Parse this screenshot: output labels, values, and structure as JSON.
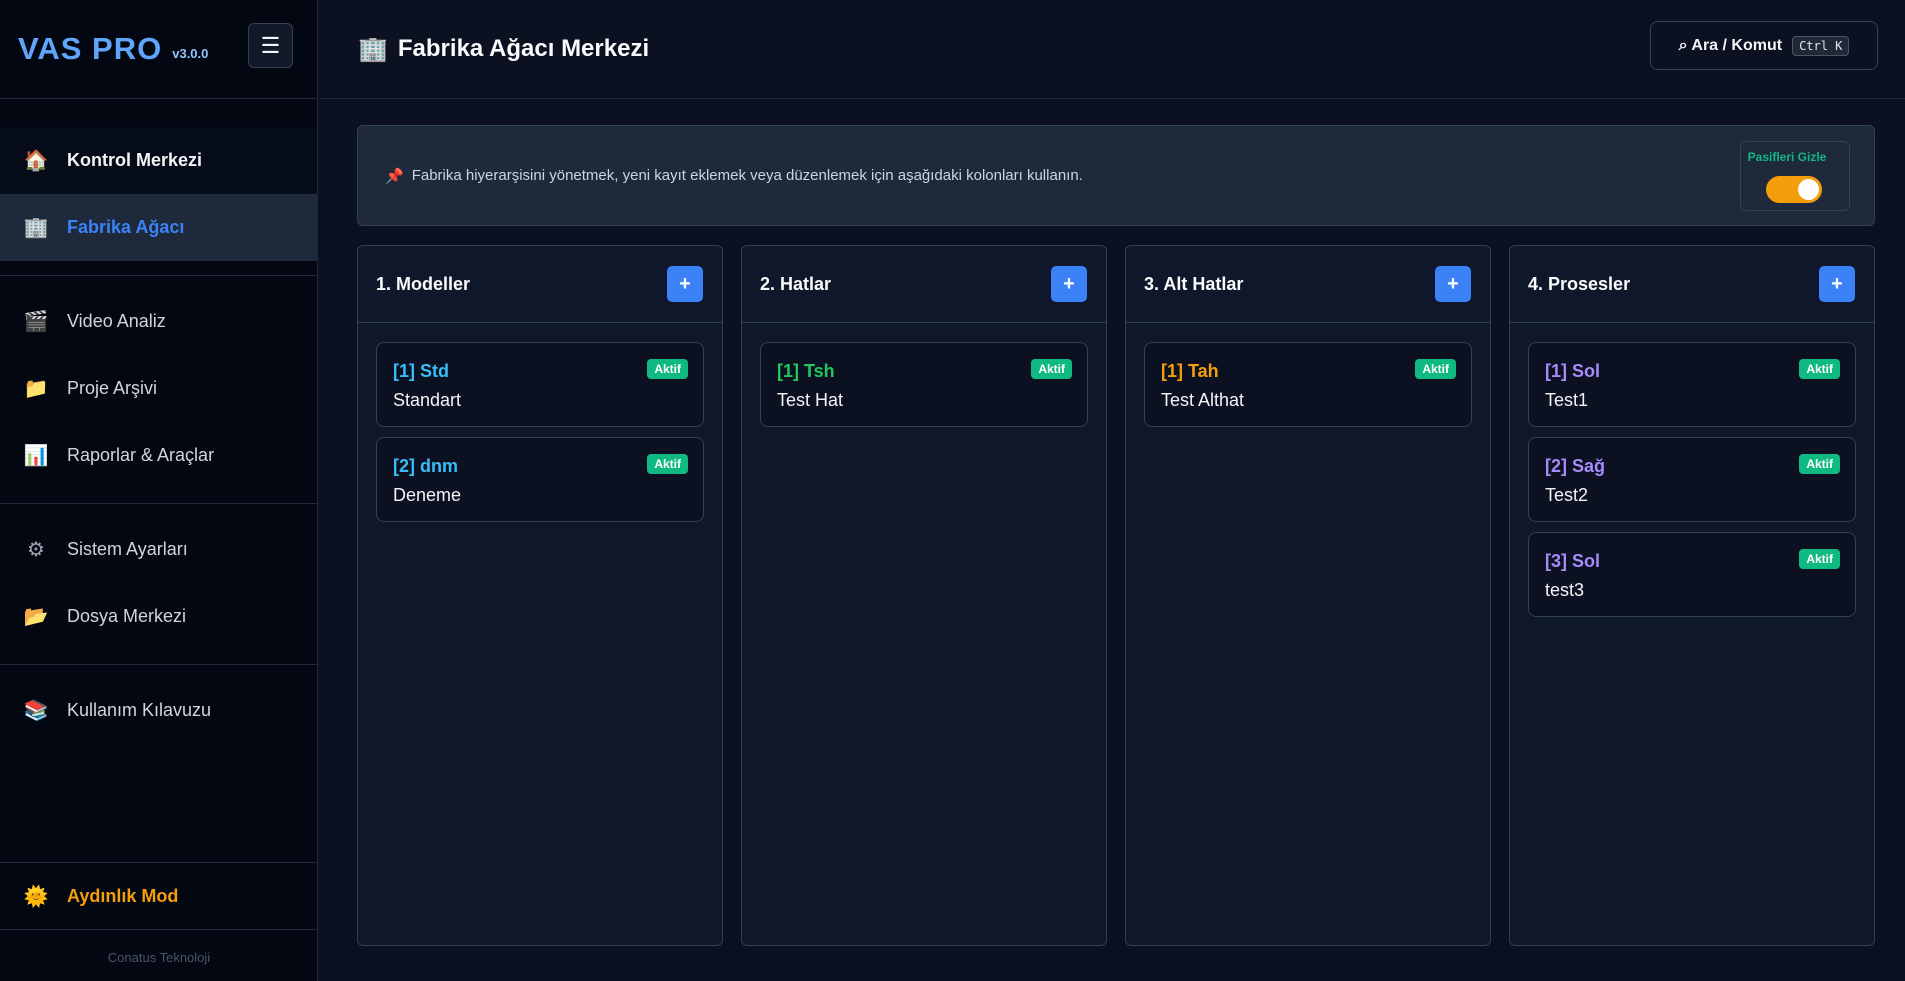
{
  "app": {
    "name": "VAS PRO",
    "version": "v3.0.0",
    "menu_icon": "☰"
  },
  "sidebar": {
    "items": [
      {
        "label": "Kontrol Merkezi",
        "icon": "🏠"
      },
      {
        "label": "Fabrika Ağacı",
        "icon": "🏢"
      },
      {
        "label": "Video Analiz",
        "icon": "🎬"
      },
      {
        "label": "Proje Arşivi",
        "icon": "📁"
      },
      {
        "label": "Raporlar & Araçlar",
        "icon": "📊"
      },
      {
        "label": "Sistem Ayarları",
        "icon": "⚙"
      },
      {
        "label": "Dosya Merkezi",
        "icon": "📂"
      },
      {
        "label": "Kullanım Kılavuzu",
        "icon": "📚"
      }
    ],
    "light_mode": {
      "label": "Aydınlık Mod",
      "icon": "🌞"
    },
    "footer": "Conatus Teknoloji"
  },
  "header": {
    "title": "Fabrika Ağacı Merkezi",
    "title_icon": "🏢",
    "search_label": "⌕ Ara / Komut",
    "search_kbd": "Ctrl K"
  },
  "info": {
    "icon": "📌",
    "text": "Fabrika hiyerarşisini yönetmek, yeni kayıt eklemek veya düzenlemek için aşağıdaki kolonları kullanın.",
    "toggle_label": "Pasifleri Gizle"
  },
  "columns": [
    {
      "title": "1. Modeller",
      "add": "+",
      "color": "#38bdf8",
      "cards": [
        {
          "code": "[1] Std",
          "name": "Standart",
          "badge": "Aktif"
        },
        {
          "code": "[2] dnm",
          "name": "Deneme",
          "badge": "Aktif"
        }
      ]
    },
    {
      "title": "2. Hatlar",
      "add": "+",
      "color": "#22c55e",
      "cards": [
        {
          "code": "[1] Tsh",
          "name": "Test Hat",
          "badge": "Aktif"
        }
      ]
    },
    {
      "title": "3. Alt Hatlar",
      "add": "+",
      "color": "#f59e0b",
      "cards": [
        {
          "code": "[1] Tah",
          "name": "Test Althat",
          "badge": "Aktif"
        }
      ]
    },
    {
      "title": "4. Prosesler",
      "add": "+",
      "color": "#a78bfa",
      "cards": [
        {
          "code": "[1] Sol",
          "name": "Test1",
          "badge": "Aktif"
        },
        {
          "code": "[2] Sağ",
          "name": "Test2",
          "badge": "Aktif"
        },
        {
          "code": "[3] Sol",
          "name": "test3",
          "badge": "Aktif"
        }
      ]
    }
  ]
}
